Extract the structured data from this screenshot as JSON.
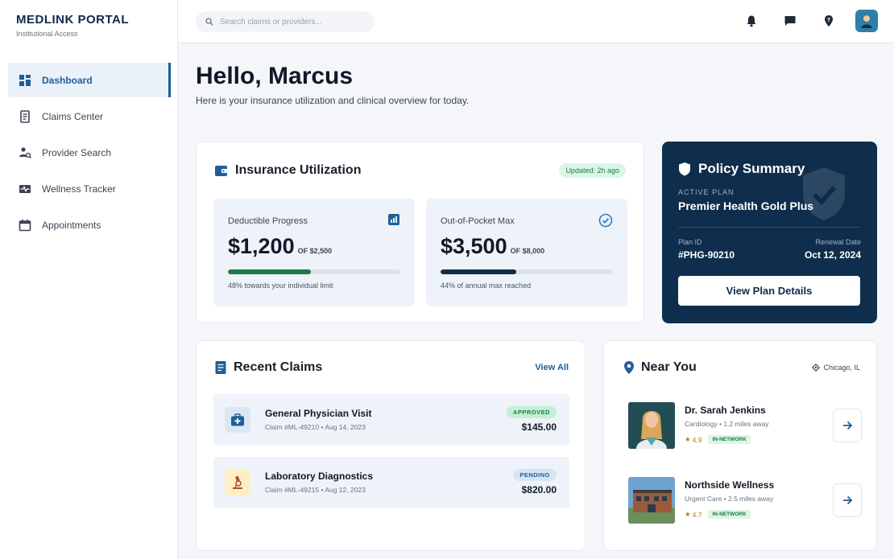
{
  "brand": {
    "title": "MEDLINK PORTAL",
    "subtitle": "Institutional Access"
  },
  "sidebar": {
    "items": [
      {
        "label": "Dashboard",
        "icon": "grid-icon",
        "active": true
      },
      {
        "label": "Claims Center",
        "icon": "document-icon"
      },
      {
        "label": "Provider Search",
        "icon": "people-search-icon"
      },
      {
        "label": "Wellness Tracker",
        "icon": "pulse-icon"
      },
      {
        "label": "Appointments",
        "icon": "calendar-icon"
      }
    ]
  },
  "topbar": {
    "search_placeholder": "Search claims or providers...",
    "icons": [
      "bell-icon",
      "chat-icon",
      "help-icon",
      "avatar"
    ]
  },
  "greeting": {
    "title": "Hello, Marcus",
    "subtitle": "Here is your insurance utilization and clinical overview for today."
  },
  "utilization": {
    "title": "Insurance Utilization",
    "updated": "Updated: 2h ago",
    "deductible": {
      "label": "Deductible Progress",
      "value": "$1,200",
      "of": "OF $2,500",
      "progress": 0.48,
      "note": "48% towards your individual limit",
      "color": "#1e7a46"
    },
    "oop": {
      "label": "Out-of-Pocket Max",
      "value": "$3,500",
      "of": "OF $8,000",
      "progress": 0.44,
      "note": "44% of annual max reached",
      "color": "#0f2e4d"
    }
  },
  "policy": {
    "title": "Policy Summary",
    "active_label": "ACTIVE PLAN",
    "plan_name": "Premier Health Gold Plus",
    "plan_id_label": "Plan ID",
    "plan_id": "#PHG-90210",
    "renewal_label": "Renewal Date",
    "renewal": "Oct 12, 2024",
    "button": "View Plan Details"
  },
  "claims": {
    "title": "Recent Claims",
    "view_all": "View All",
    "items": [
      {
        "name": "General Physician Visit",
        "meta": "Claim #ML-49210 • Aug 14, 2023",
        "status": "APPROVED",
        "amount": "$145.00",
        "icon": "medkit-icon"
      },
      {
        "name": "Laboratory Diagnostics",
        "meta": "Claim #ML-49215 • Aug 12, 2023",
        "status": "PENDING",
        "amount": "$820.00",
        "icon": "microscope-icon"
      }
    ]
  },
  "near": {
    "title": "Near You",
    "location": "Chicago, IL",
    "items": [
      {
        "name": "Dr. Sarah Jenkins",
        "sub": "Cardiology • 1.2 miles away",
        "rating": "4.9",
        "tag": "IN-NETWORK"
      },
      {
        "name": "Northside Wellness",
        "sub": "Urgent Care • 2.5 miles away",
        "rating": "4.7",
        "tag": "IN-NETWORK"
      }
    ]
  }
}
